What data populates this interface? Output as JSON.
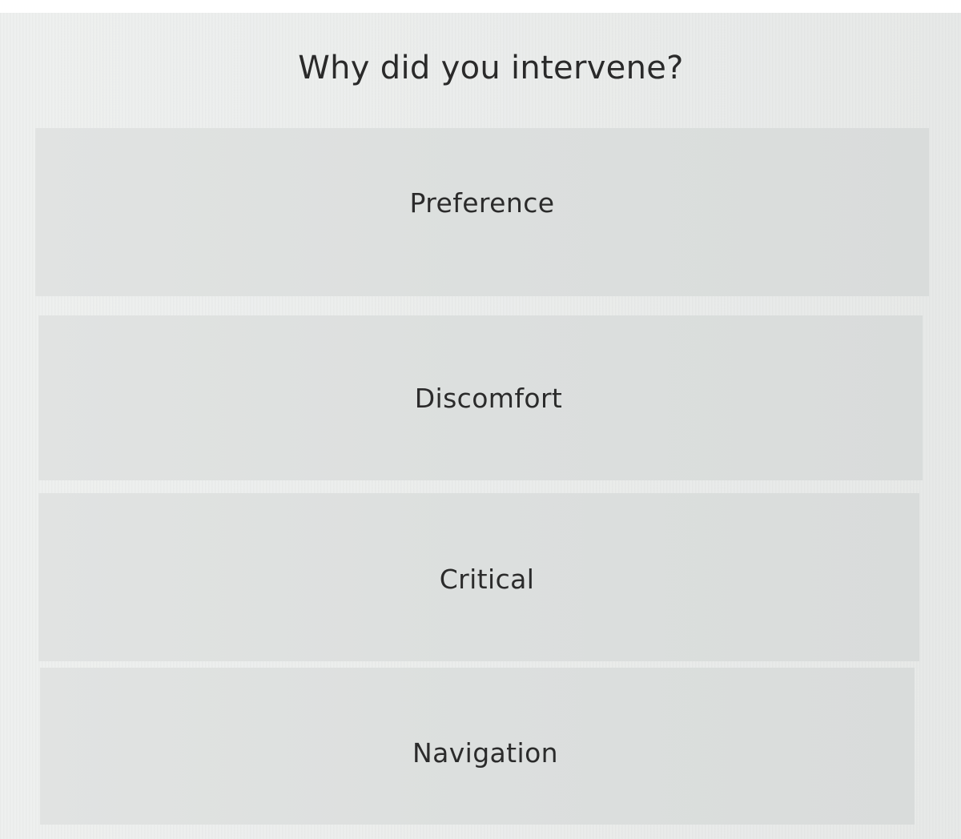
{
  "dialog": {
    "title": "Why did you intervene?",
    "options": [
      {
        "label": "Preference"
      },
      {
        "label": "Discomfort"
      },
      {
        "label": "Critical"
      },
      {
        "label": "Navigation"
      }
    ]
  }
}
